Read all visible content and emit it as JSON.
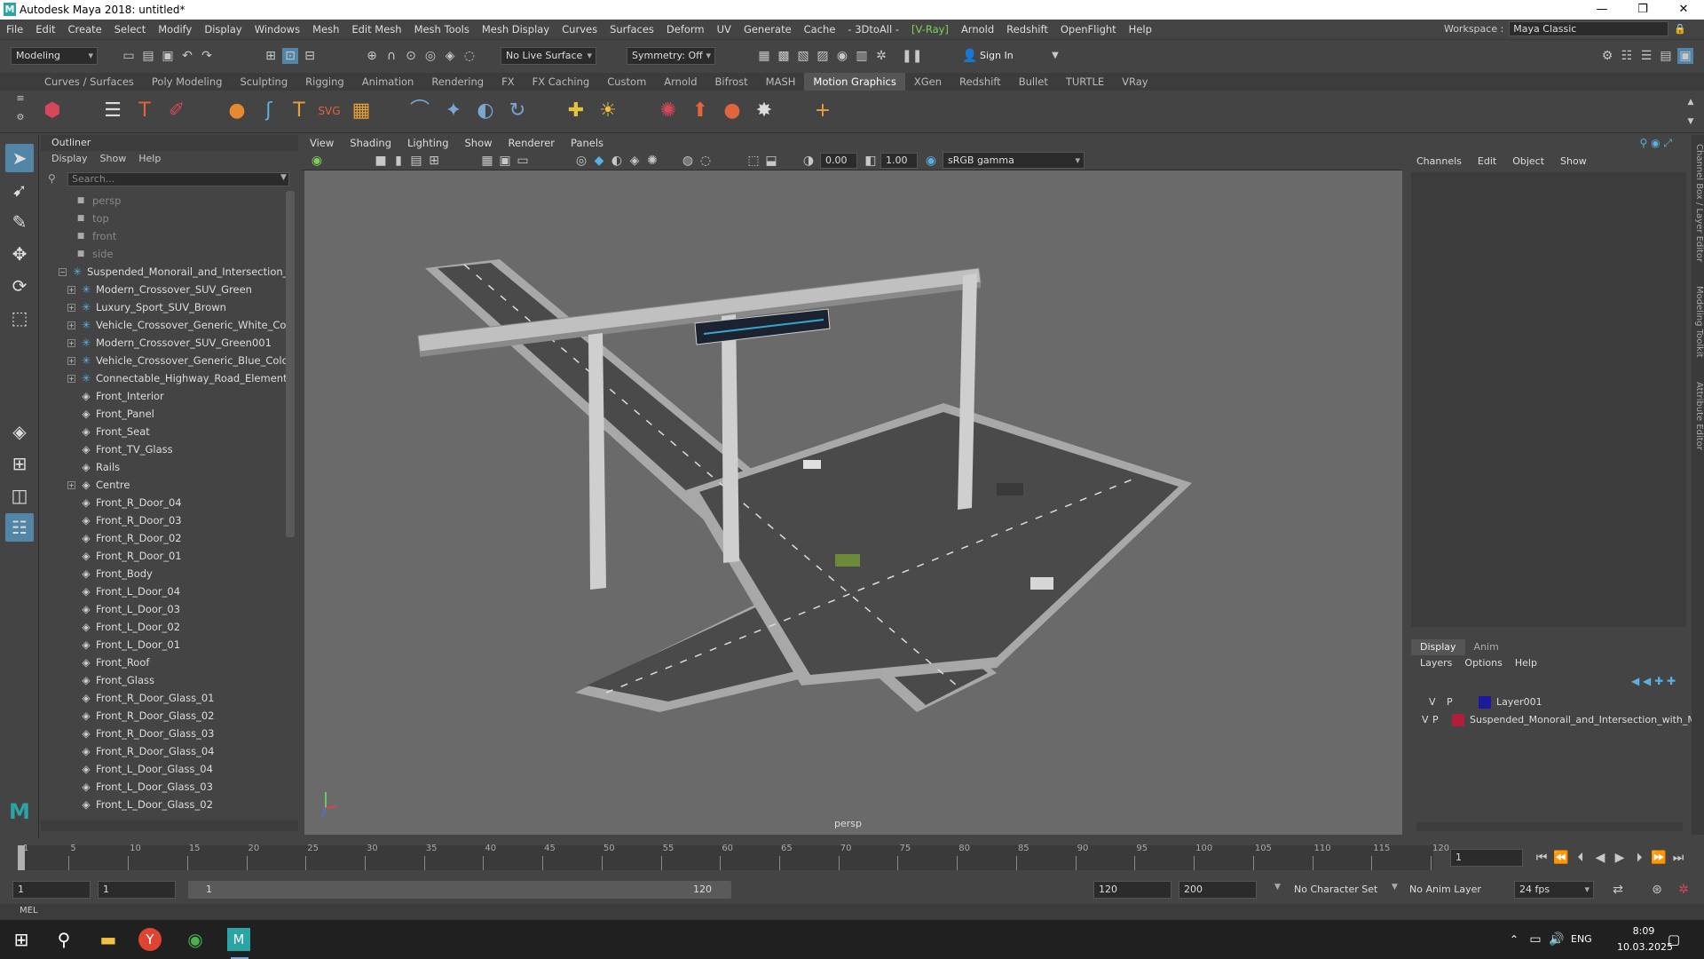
{
  "window": {
    "title": "Autodesk Maya 2018: untitled*",
    "logo": "M"
  },
  "menubar": {
    "items": [
      "File",
      "Edit",
      "Create",
      "Select",
      "Modify",
      "Display",
      "Windows",
      "Mesh",
      "Edit Mesh",
      "Mesh Tools",
      "Mesh Display",
      "Curves",
      "Surfaces",
      "Deform",
      "UV",
      "Generate",
      "Cache",
      "- 3DtoAll -",
      "[V-Ray]",
      "Arnold",
      "Redshift",
      "OpenFlight",
      "Help"
    ],
    "workspace_label": "Workspace :",
    "workspace_value": "Maya Classic"
  },
  "statusline": {
    "mode": "Modeling",
    "live_surface": "No Live Surface",
    "symmetry": "Symmetry: Off",
    "sign_in": "Sign In"
  },
  "shelf_tabs": [
    "Curves / Surfaces",
    "Poly Modeling",
    "Sculpting",
    "Rigging",
    "Animation",
    "Rendering",
    "FX",
    "FX Caching",
    "Custom",
    "Arnold",
    "Bifrost",
    "MASH",
    "Motion Graphics",
    "XGen",
    "Redshift",
    "Bullet",
    "TURTLE",
    "VRay"
  ],
  "shelf_active": "Motion Graphics",
  "outliner": {
    "title": "Outliner",
    "menu": [
      "Display",
      "Show",
      "Help"
    ],
    "search_placeholder": "Search...",
    "items": [
      {
        "label": "persp",
        "type": "cam",
        "indent": 0
      },
      {
        "label": "top",
        "type": "cam",
        "indent": 0
      },
      {
        "label": "front",
        "type": "cam",
        "indent": 0
      },
      {
        "label": "side",
        "type": "cam",
        "indent": 0
      },
      {
        "label": "Suspended_Monorail_and_Intersection_wi",
        "type": "group",
        "indent": 0,
        "expanded": true
      },
      {
        "label": "Modern_Crossover_SUV_Green",
        "type": "group",
        "indent": 1
      },
      {
        "label": "Luxury_Sport_SUV_Brown",
        "type": "group",
        "indent": 1
      },
      {
        "label": "Vehicle_Crossover_Generic_White_Color",
        "type": "group",
        "indent": 1
      },
      {
        "label": "Modern_Crossover_SUV_Green001",
        "type": "group",
        "indent": 1
      },
      {
        "label": "Vehicle_Crossover_Generic_Blue_Color",
        "type": "group",
        "indent": 1
      },
      {
        "label": "Connectable_Highway_Road_Elements_(",
        "type": "group",
        "indent": 1
      },
      {
        "label": "Front_Interior",
        "type": "mesh",
        "indent": 1
      },
      {
        "label": "Front_Panel",
        "type": "mesh",
        "indent": 1
      },
      {
        "label": "Front_Seat",
        "type": "mesh",
        "indent": 1
      },
      {
        "label": "Front_TV_Glass",
        "type": "mesh",
        "indent": 1
      },
      {
        "label": "Rails",
        "type": "mesh",
        "indent": 1
      },
      {
        "label": "Centre",
        "type": "mesh",
        "indent": 1,
        "expandable": true
      },
      {
        "label": "Front_R_Door_04",
        "type": "mesh",
        "indent": 1
      },
      {
        "label": "Front_R_Door_03",
        "type": "mesh",
        "indent": 1
      },
      {
        "label": "Front_R_Door_02",
        "type": "mesh",
        "indent": 1
      },
      {
        "label": "Front_R_Door_01",
        "type": "mesh",
        "indent": 1
      },
      {
        "label": "Front_Body",
        "type": "mesh",
        "indent": 1
      },
      {
        "label": "Front_L_Door_04",
        "type": "mesh",
        "indent": 1
      },
      {
        "label": "Front_L_Door_03",
        "type": "mesh",
        "indent": 1
      },
      {
        "label": "Front_L_Door_02",
        "type": "mesh",
        "indent": 1
      },
      {
        "label": "Front_L_Door_01",
        "type": "mesh",
        "indent": 1
      },
      {
        "label": "Front_Roof",
        "type": "mesh",
        "indent": 1
      },
      {
        "label": "Front_Glass",
        "type": "mesh",
        "indent": 1
      },
      {
        "label": "Front_R_Door_Glass_01",
        "type": "mesh",
        "indent": 1
      },
      {
        "label": "Front_R_Door_Glass_02",
        "type": "mesh",
        "indent": 1
      },
      {
        "label": "Front_R_Door_Glass_03",
        "type": "mesh",
        "indent": 1
      },
      {
        "label": "Front_R_Door_Glass_04",
        "type": "mesh",
        "indent": 1
      },
      {
        "label": "Front_L_Door_Glass_04",
        "type": "mesh",
        "indent": 1
      },
      {
        "label": "Front_L_Door_Glass_03",
        "type": "mesh",
        "indent": 1
      },
      {
        "label": "Front_L_Door_Glass_02",
        "type": "mesh",
        "indent": 1
      }
    ]
  },
  "viewport": {
    "menu": [
      "View",
      "Shading",
      "Lighting",
      "Show",
      "Renderer",
      "Panels"
    ],
    "exposure": "0.00",
    "gamma": "1.00",
    "color_space": "sRGB gamma",
    "camera_label": "persp"
  },
  "channelbox": {
    "menu": [
      "Channels",
      "Edit",
      "Object",
      "Show"
    ]
  },
  "layers": {
    "tabs": [
      "Display",
      "Anim"
    ],
    "menu": [
      "Layers",
      "Options",
      "Help"
    ],
    "rows": [
      {
        "v": "V",
        "p": "P",
        "name": "Layer001",
        "color": "#1a1a9a"
      },
      {
        "v": "V",
        "p": "P",
        "name": "Suspended_Monorail_and_Intersection_with_M",
        "color": "#b01e3a"
      }
    ]
  },
  "side_tabs": [
    "Channel Box / Layer Editor",
    "Modeling Toolkit",
    "Attribute Editor"
  ],
  "timeline": {
    "ticks": [
      "1",
      "5",
      "10",
      "15",
      "20",
      "25",
      "30",
      "35",
      "40",
      "45",
      "50",
      "55",
      "60",
      "65",
      "70",
      "75",
      "80",
      "85",
      "90",
      "95",
      "100",
      "105",
      "110",
      "115",
      "120"
    ],
    "current_frame": "1"
  },
  "range": {
    "start": "1",
    "start2": "1",
    "slider_start": "1",
    "slider_end": "120",
    "end": "120",
    "max": "200",
    "character_set": "No Character Set",
    "anim_layer": "No Anim Layer",
    "fps": "24 fps"
  },
  "mel": {
    "label": "MEL"
  },
  "taskbar": {
    "lang": "ENG",
    "time": "8:09",
    "date": "10.03.2025"
  },
  "colors": {
    "accent": "#5285a6",
    "vray": "#7dd35a"
  }
}
